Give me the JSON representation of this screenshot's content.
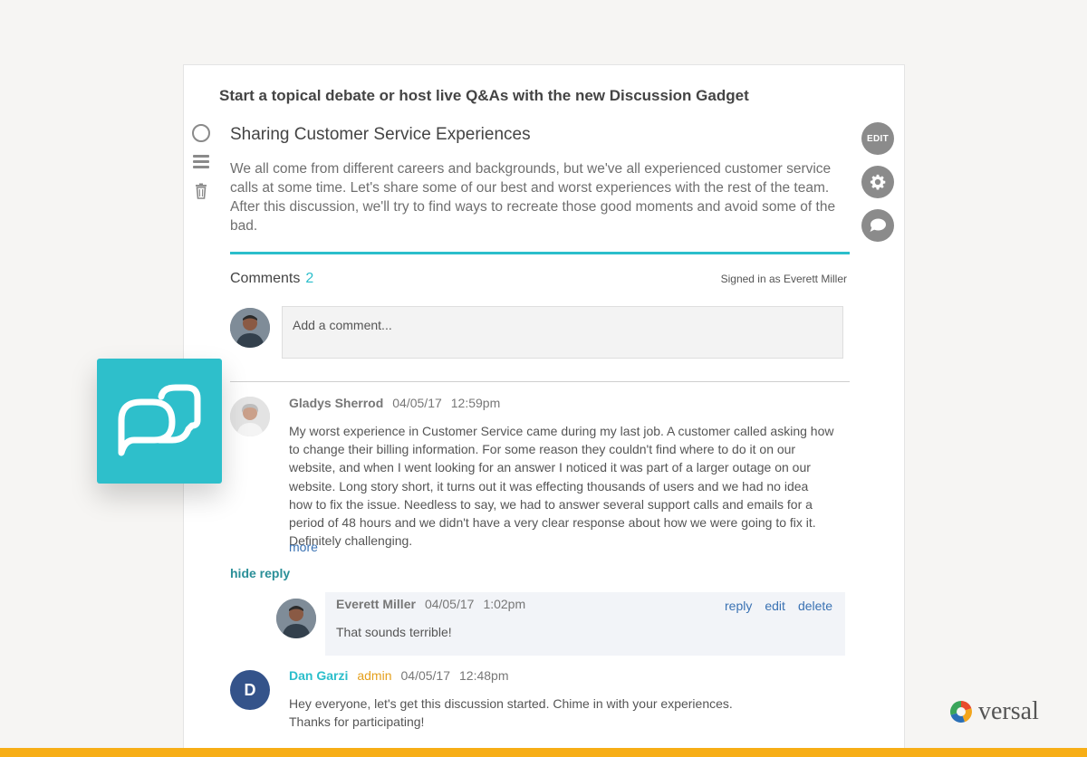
{
  "headline": "Start a topical debate or host live Q&As with the new Discussion Gadget",
  "discussion": {
    "title": "Sharing Customer Service Experiences",
    "description": "We all come from different careers and backgrounds, but we've all experienced customer service calls at some time. Let's share some of our best and worst experiences with the rest of the team. After this discussion, we'll try to find ways to recreate those good moments and avoid some of the bad."
  },
  "toolbar": {
    "edit_label": "EDIT"
  },
  "comments": {
    "label": "Comments",
    "count": "2",
    "signed_in": "Signed in as Everett Miller",
    "input_placeholder": "Add a comment..."
  },
  "thread": [
    {
      "author": "Gladys Sherrod",
      "date": "04/05/17",
      "time": "12:59pm",
      "text": "My worst experience in Customer Service came during my last job. A customer called asking how to change their billing information. For some reason they couldn't find where to do it on our website, and when I went looking for an answer I noticed it was part of a larger outage on our website. Long story short, it turns out it was effecting thousands of users and we had no idea how to fix the issue. Needless to say, we had to answer several support calls and emails for a period of 48 hours and we didn't have a very clear response about how we were going to fix it. Definitely challenging.",
      "more_label": "more",
      "hide_reply_label": "hide reply"
    },
    {
      "author": "Everett Miller",
      "date": "04/05/17",
      "time": "1:02pm",
      "text": "That sounds terrible!",
      "actions": {
        "reply": "reply",
        "edit": "edit",
        "delete": "delete"
      }
    },
    {
      "author": "Dan Garzi",
      "role": "admin",
      "initial": "D",
      "date": "04/05/17",
      "time": "12:48pm",
      "text_line1": "Hey everyone, let's get this discussion started. Chime in with your experiences.",
      "text_line2": "Thanks for participating!"
    }
  ],
  "brand": {
    "name": "versal"
  },
  "colors": {
    "teal": "#2bbecb",
    "accent_orange": "#f7ae16",
    "link_blue": "#3a72b3",
    "admin_orange": "#e5a01c",
    "avatar_navy": "#34538a"
  }
}
